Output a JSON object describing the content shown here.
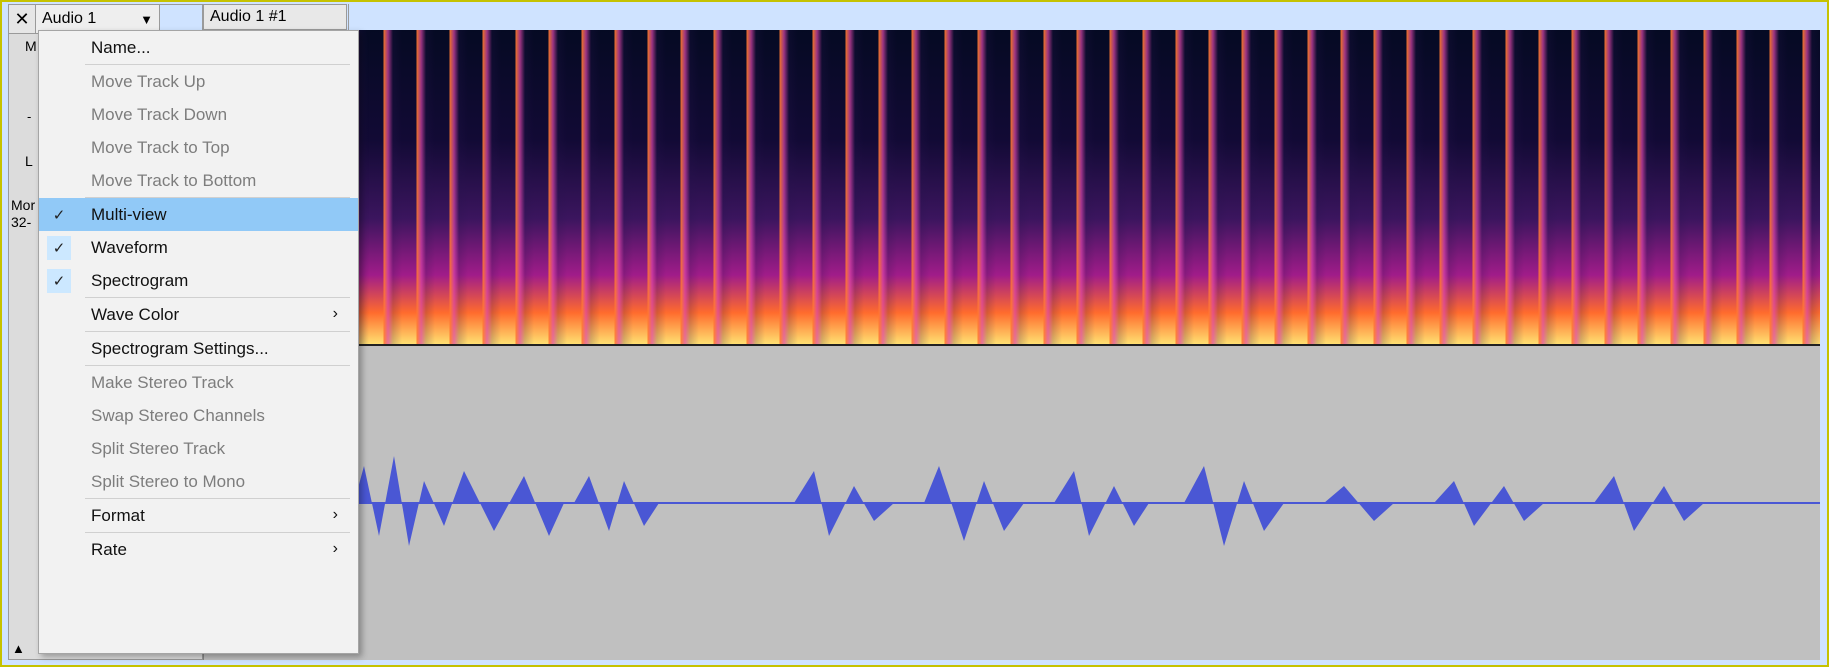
{
  "track": {
    "name": "Audio 1",
    "mute_label": "M",
    "info_lines": [
      "Mor",
      "32-"
    ],
    "gain_minus": "-",
    "pan_l": "L"
  },
  "clip": {
    "title": "Audio 1 #1"
  },
  "context_menu": {
    "items": [
      {
        "label": "Name...",
        "enabled": true,
        "checked": false,
        "submenu": false
      },
      {
        "sep": true
      },
      {
        "label": "Move Track Up",
        "enabled": false,
        "checked": false,
        "submenu": false
      },
      {
        "label": "Move Track Down",
        "enabled": false,
        "checked": false,
        "submenu": false
      },
      {
        "label": "Move Track to Top",
        "enabled": false,
        "checked": false,
        "submenu": false
      },
      {
        "label": "Move Track to Bottom",
        "enabled": false,
        "checked": false,
        "submenu": false
      },
      {
        "sep": true
      },
      {
        "label": "Multi-view",
        "enabled": true,
        "checked": true,
        "submenu": false,
        "selected": true
      },
      {
        "label": "Waveform",
        "enabled": true,
        "checked": true,
        "submenu": false
      },
      {
        "label": "Spectrogram",
        "enabled": true,
        "checked": true,
        "submenu": false
      },
      {
        "sep": true
      },
      {
        "label": "Wave Color",
        "enabled": true,
        "checked": false,
        "submenu": true
      },
      {
        "sep": true
      },
      {
        "label": "Spectrogram Settings...",
        "enabled": true,
        "checked": false,
        "submenu": false
      },
      {
        "sep": true
      },
      {
        "label": "Make Stereo Track",
        "enabled": false,
        "checked": false,
        "submenu": false
      },
      {
        "label": "Swap Stereo Channels",
        "enabled": false,
        "checked": false,
        "submenu": false
      },
      {
        "label": "Split Stereo Track",
        "enabled": false,
        "checked": false,
        "submenu": false
      },
      {
        "label": "Split Stereo to Mono",
        "enabled": false,
        "checked": false,
        "submenu": false
      },
      {
        "sep": true
      },
      {
        "label": "Format",
        "enabled": true,
        "checked": false,
        "submenu": true
      },
      {
        "sep": true
      },
      {
        "label": "Rate",
        "enabled": true,
        "checked": false,
        "submenu": true
      }
    ]
  },
  "colors": {
    "selection_blue": "#91c9f7",
    "waveform_blue": "#4a57d4",
    "frame_yellow": "#c6c200"
  },
  "icons": {
    "close": "close-icon",
    "dropdown": "chevron-down-icon",
    "check": "check-icon",
    "submenu": "chevron-right-icon",
    "collapse": "triangle-up-icon"
  }
}
